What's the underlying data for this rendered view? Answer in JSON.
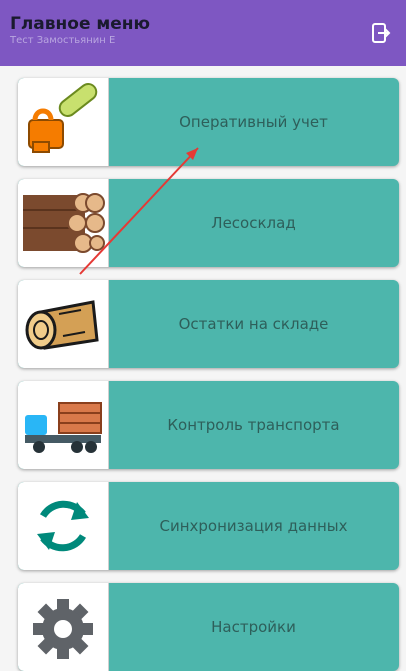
{
  "header": {
    "title": "Главное меню",
    "subtitle": "Тест Замостьянин Е",
    "exit_icon": "exit-icon"
  },
  "menu": {
    "items": [
      {
        "label": "Оперативный учет",
        "icon": "chainsaw-icon"
      },
      {
        "label": "Лесосклад",
        "icon": "log-pile-icon"
      },
      {
        "label": "Остатки на складе",
        "icon": "log-icon"
      },
      {
        "label": "Контроль транспорта",
        "icon": "timber-truck-icon"
      },
      {
        "label": "Синхронизация данных",
        "icon": "sync-icon"
      },
      {
        "label": "Настройки",
        "icon": "gear-icon"
      }
    ]
  },
  "colors": {
    "header_bg": "#7e57c2",
    "tile_bg": "#4db6ac",
    "annotation": "#e53935"
  }
}
